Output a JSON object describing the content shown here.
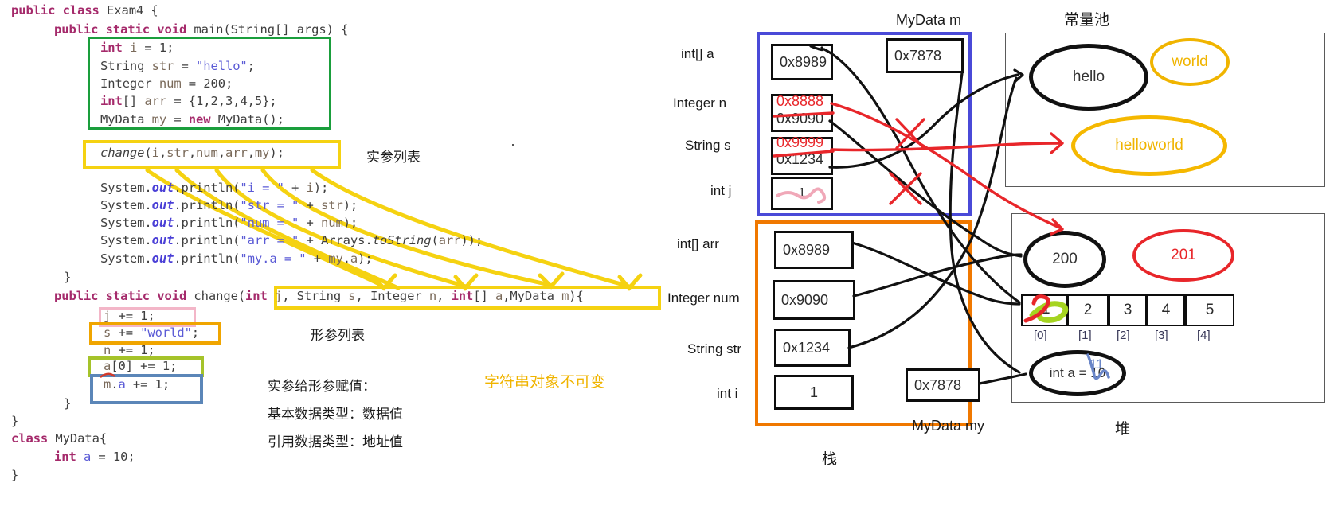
{
  "code": {
    "lines": [
      "public class Exam4 {",
      "public static void main(String[] args) {",
      "int i = 1;",
      "String str = \"hello\";",
      "Integer num = 200;",
      "int[] arr = {1,2,3,4,5};",
      "MyData my = new MyData();",
      "change(i,str,num,arr,my);",
      "System.out.println(\"i = \" + i);",
      "System.out.println(\"str = \" + str);",
      "System.out.println(\"num = \" + num);",
      "System.out.println(\"arr = \" + Arrays.toString(arr));",
      "System.out.println(\"my.a = \" + my.a);",
      "}",
      "public static void change(int j, String s, Integer n, int[] a,MyData m){",
      "j += 1;",
      "s += \"world\";",
      "n += 1;",
      "a[0] += 1;",
      "m.a += 1;",
      "}",
      "}",
      "class MyData{",
      "int a = 10;",
      "}"
    ]
  },
  "annotations": {
    "actual_params": "实参列表",
    "formal_params": "形参列表",
    "assign_title": "实参给形参赋值：",
    "assign_primitive": "基本数据类型：数据值",
    "assign_reference": "引用数据类型：地址值",
    "string_immutable": "字符串对象不可变"
  },
  "diagram": {
    "stack_label": "栈",
    "heap_label": "堆",
    "constant_pool_label": "常量池",
    "frame_change_label": "MyData m",
    "frame_main_label": "MyData my",
    "frame_change": {
      "rows": [
        {
          "type": "int[]  a",
          "value": "0x8989"
        },
        {
          "type": "Integer n",
          "value": "0x9090",
          "new_value": "0x8888",
          "struck": true
        },
        {
          "type": "String  s",
          "value": "0x1234",
          "new_value": "0x9999",
          "struck": true
        },
        {
          "type": "int  j",
          "value": "1",
          "scribbled": true
        }
      ],
      "extra_box": "0x7878"
    },
    "frame_main": {
      "rows": [
        {
          "type": "int[]   arr",
          "value": "0x8989"
        },
        {
          "type": "Integer num",
          "value": "0x9090"
        },
        {
          "type": "String str",
          "value": "0x1234"
        },
        {
          "type": "int  i",
          "value": "1"
        }
      ],
      "extra_box": "0x7878"
    },
    "constant_pool": {
      "items": [
        {
          "text": "hello",
          "color": "#111111"
        },
        {
          "text": "world",
          "color": "#f0b400"
        },
        {
          "text": "helloworld",
          "color": "#f0b400"
        }
      ]
    },
    "heap": {
      "integer_obj": "200",
      "integer_new_obj": "201",
      "array": {
        "values": [
          "1",
          "2",
          "3",
          "4",
          "5"
        ],
        "overwritten_first": "2",
        "indices": [
          "[0]",
          "[1]",
          "[2]",
          "[3]",
          "[4]"
        ]
      },
      "mydata_obj": "int a = 10",
      "mydata_obj_new": "11"
    }
  },
  "colors": {
    "green_box": "#1a9e3c",
    "yellow_box": "#f5d211",
    "pink_box": "#f3b6c8",
    "orange_box": "#f0a500",
    "olive_box": "#a5c32a",
    "blue_box": "#5b86b8",
    "frame_change_border": "#4a4ad8",
    "frame_main_border": "#f07800",
    "red_ink": "#e8262a"
  }
}
